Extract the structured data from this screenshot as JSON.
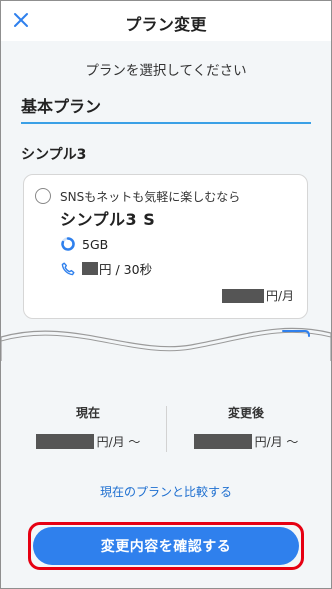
{
  "header": {
    "title": "プラン変更",
    "close_icon": "close-icon"
  },
  "instruction": "プランを選択してください",
  "section": {
    "title": "基本プラン"
  },
  "plan_group": {
    "title": "シンプル3"
  },
  "plan_card": {
    "description": "SNSもネットも気軽に楽しむなら",
    "name": "シンプル3 S",
    "data_amount": "5GB",
    "call_rate_suffix": "円 / 30秒",
    "price_unit": "円/月"
  },
  "compare": {
    "current_label": "現在",
    "current_value_suffix": "円/月 〜",
    "after_label": "変更後",
    "after_value_suffix": "円/月 〜"
  },
  "compare_link": "現在のプランと比較する",
  "confirm_button": "変更内容を確認する",
  "colors": {
    "accent_blue": "#2f80ed",
    "link_blue": "#1e6fd0",
    "underline_blue": "#3aa0e6",
    "highlight_red": "#e60012"
  }
}
